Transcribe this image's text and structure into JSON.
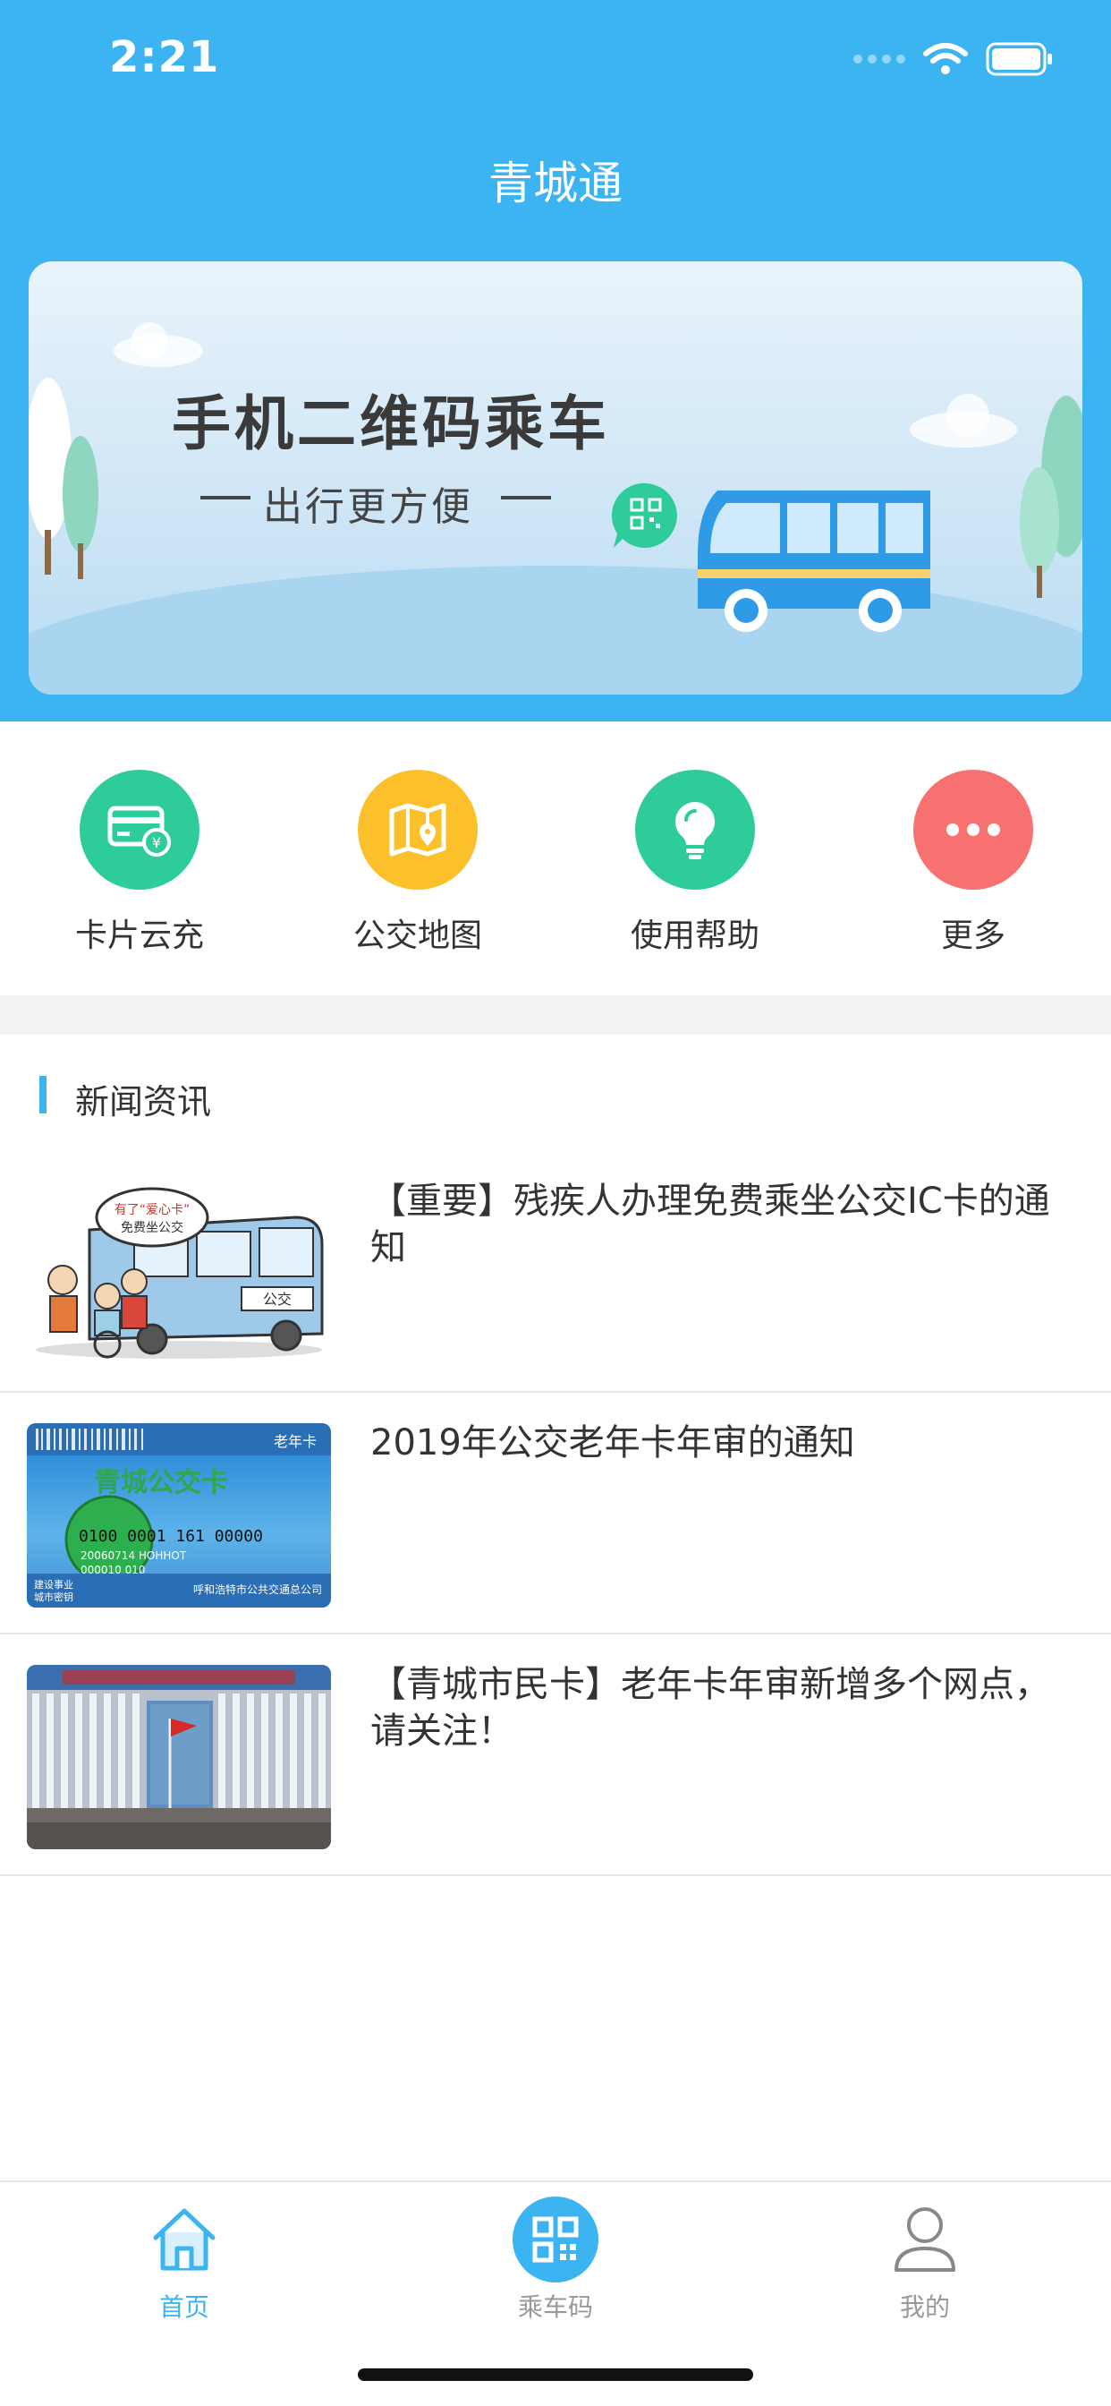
{
  "status_bar": {
    "time": "2:21"
  },
  "header": {
    "title": "青城通"
  },
  "banner": {
    "title": "手机二维码乘车",
    "subtitle": "出行更方便"
  },
  "actions": [
    {
      "label": "卡片云充",
      "icon": "card-recharge-icon",
      "color": "#2ecc9a"
    },
    {
      "label": "公交地图",
      "icon": "map-icon",
      "color": "#fcc02a"
    },
    {
      "label": "使用帮助",
      "icon": "lightbulb-icon",
      "color": "#2ecc9a"
    },
    {
      "label": "更多",
      "icon": "more-icon",
      "color": "#f87171"
    }
  ],
  "news": {
    "section_title": "新闻资讯",
    "items": [
      {
        "title": "【重要】残疾人办理免费乘坐公交IC卡的通知",
        "thumb_icon": "bus-cartoon-image",
        "thumb_text": [
          "有了“爱心卡”",
          "免费坐公交",
          "公交"
        ]
      },
      {
        "title": "2019年公交老年卡年审的通知",
        "thumb_icon": "bus-card-image",
        "thumb_text": [
          "老年卡",
          "青城公交卡",
          "0100 0001 161 00000",
          "20060714 HOHHOT",
          "000010 010",
          "建设事业",
          "城市密钥",
          "呼和浩特市公共交通总公司"
        ]
      },
      {
        "title": "【青城市民卡】老年卡年审新增多个网点，请关注！",
        "thumb_icon": "building-photo-image"
      }
    ]
  },
  "tabbar": {
    "items": [
      {
        "label": "首页",
        "icon": "home-icon",
        "active": true
      },
      {
        "label": "乘车码",
        "icon": "qr-code-icon",
        "active": false
      },
      {
        "label": "我的",
        "icon": "user-icon",
        "active": false
      }
    ]
  },
  "colors": {
    "primary": "#3db4f2",
    "background": "#ffffff",
    "divider": "#f2f2f2"
  }
}
